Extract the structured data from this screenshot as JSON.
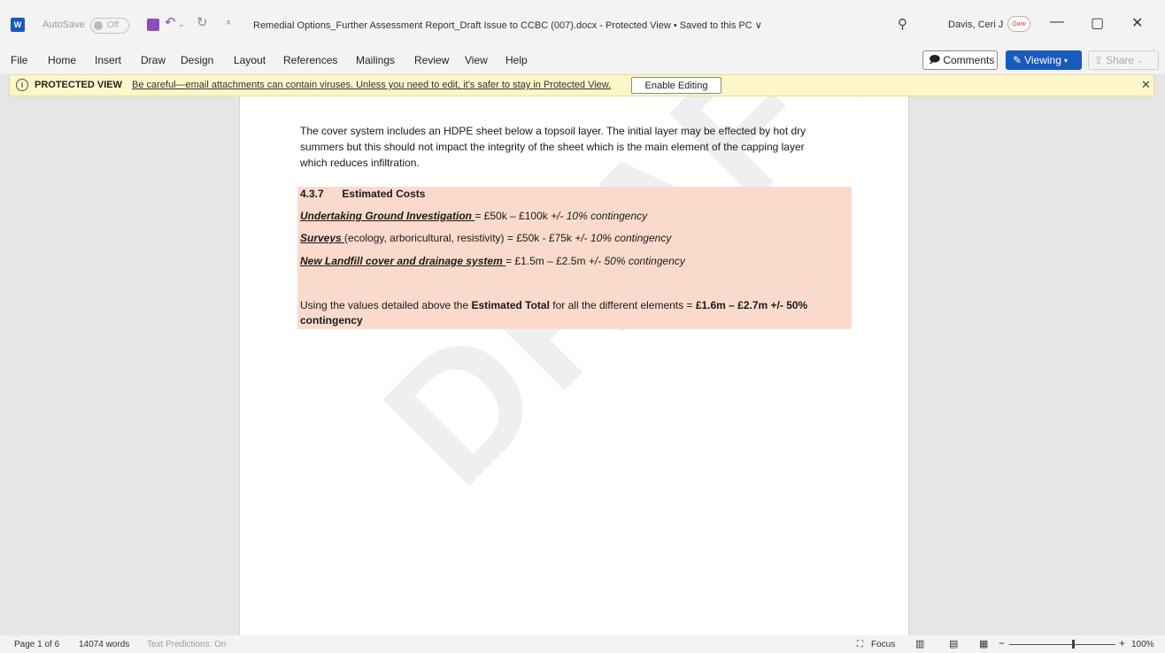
{
  "titlebar": {
    "app_icon": "W",
    "autosave_label": "AutoSave",
    "autosave_state": "Off",
    "document_title": "Remedial Options_Further Assessment Report_Draft Issue to CCBC (007).docx  -  Protected View • Saved to this PC ∨",
    "user_name": "Davis, Ceri J",
    "avatar_text": "Gww",
    "minimize": "—",
    "maximize": "▢",
    "close": "✕"
  },
  "ribbon": {
    "tabs": [
      "File",
      "Home",
      "Insert",
      "Draw",
      "Design",
      "Layout",
      "References",
      "Mailings",
      "Review",
      "View",
      "Help"
    ],
    "comments_label": "Comments",
    "viewing_label": "Viewing",
    "share_label": "Share"
  },
  "protected_view": {
    "label": "PROTECTED VIEW",
    "message": "Be careful—email attachments can contain viruses. Unless you need to edit, it's safer to stay in Protected View.",
    "enable_button": "Enable Editing",
    "close": "✕"
  },
  "document": {
    "watermark": "DRAFT",
    "paragraph_lines": [
      "The cover system includes an HDPE sheet below a topsoil layer.  The initial layer may be effected by hot dry",
      "summers but this should not impact the integrity of the sheet which is the main element of the capping layer",
      "which reduces infiltration."
    ],
    "section_number": "4.3.7",
    "section_title": "Estimated Costs",
    "cost1_label": "Undertaking Ground Investigation ",
    "cost1_value": "= £50k – £100k ",
    "cost1_contingency": "+/- 10% contingency",
    "cost2_label": "Surveys ",
    "cost2_value": "(ecology, arboricultural, resistivity) = £50k - £75k ",
    "cost2_contingency": "+/- 10% contingency",
    "cost3_label": "New Landfill cover and drainage system ",
    "cost3_value": " = £1.5m – £2.5m ",
    "cost3_contingency": "+/- 50% contingency",
    "total_prefix": "Using the values detailed above the ",
    "total_bold": "Estimated Total",
    "total_mid": " for all the different elements = ",
    "total_value": "£1.6m – £2.7m +/- 50%",
    "total_line2": "contingency"
  },
  "statusbar": {
    "page": "Page 1 of 6",
    "words": "14074 words",
    "predictions": "Text Predictions: On",
    "focus": "Focus",
    "zoom": "100%"
  }
}
